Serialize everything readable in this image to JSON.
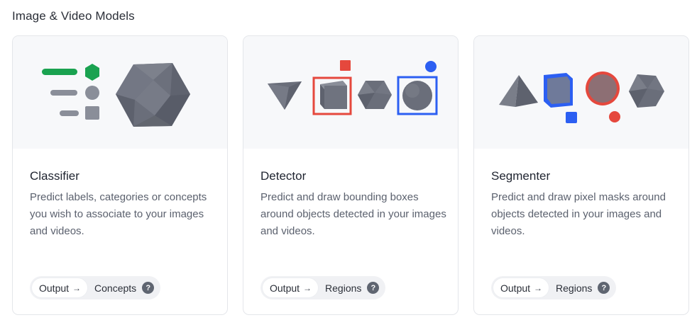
{
  "section": {
    "title": "Image & Video Models"
  },
  "cards": [
    {
      "title": "Classifier",
      "description": "Predict labels, categories or concepts you wish to associate to your images and videos.",
      "output_label": "Output",
      "output_value": "Concepts",
      "help": "?"
    },
    {
      "title": "Detector",
      "description": "Predict and draw bounding boxes around objects detected in your images and videos.",
      "output_label": "Output",
      "output_value": "Regions",
      "help": "?"
    },
    {
      "title": "Segmenter",
      "description": "Predict and draw pixel masks around objects detected in your images and videos.",
      "output_label": "Output",
      "output_value": "Regions",
      "help": "?"
    }
  ],
  "colors": {
    "green": "#1aa250",
    "red": "#e5483d",
    "blue": "#2c5ff2",
    "shape_gray": "#6e7280",
    "bar_gray": "#8a8e99"
  },
  "icons": {
    "arrow": "→",
    "help": "question-circle-icon"
  }
}
